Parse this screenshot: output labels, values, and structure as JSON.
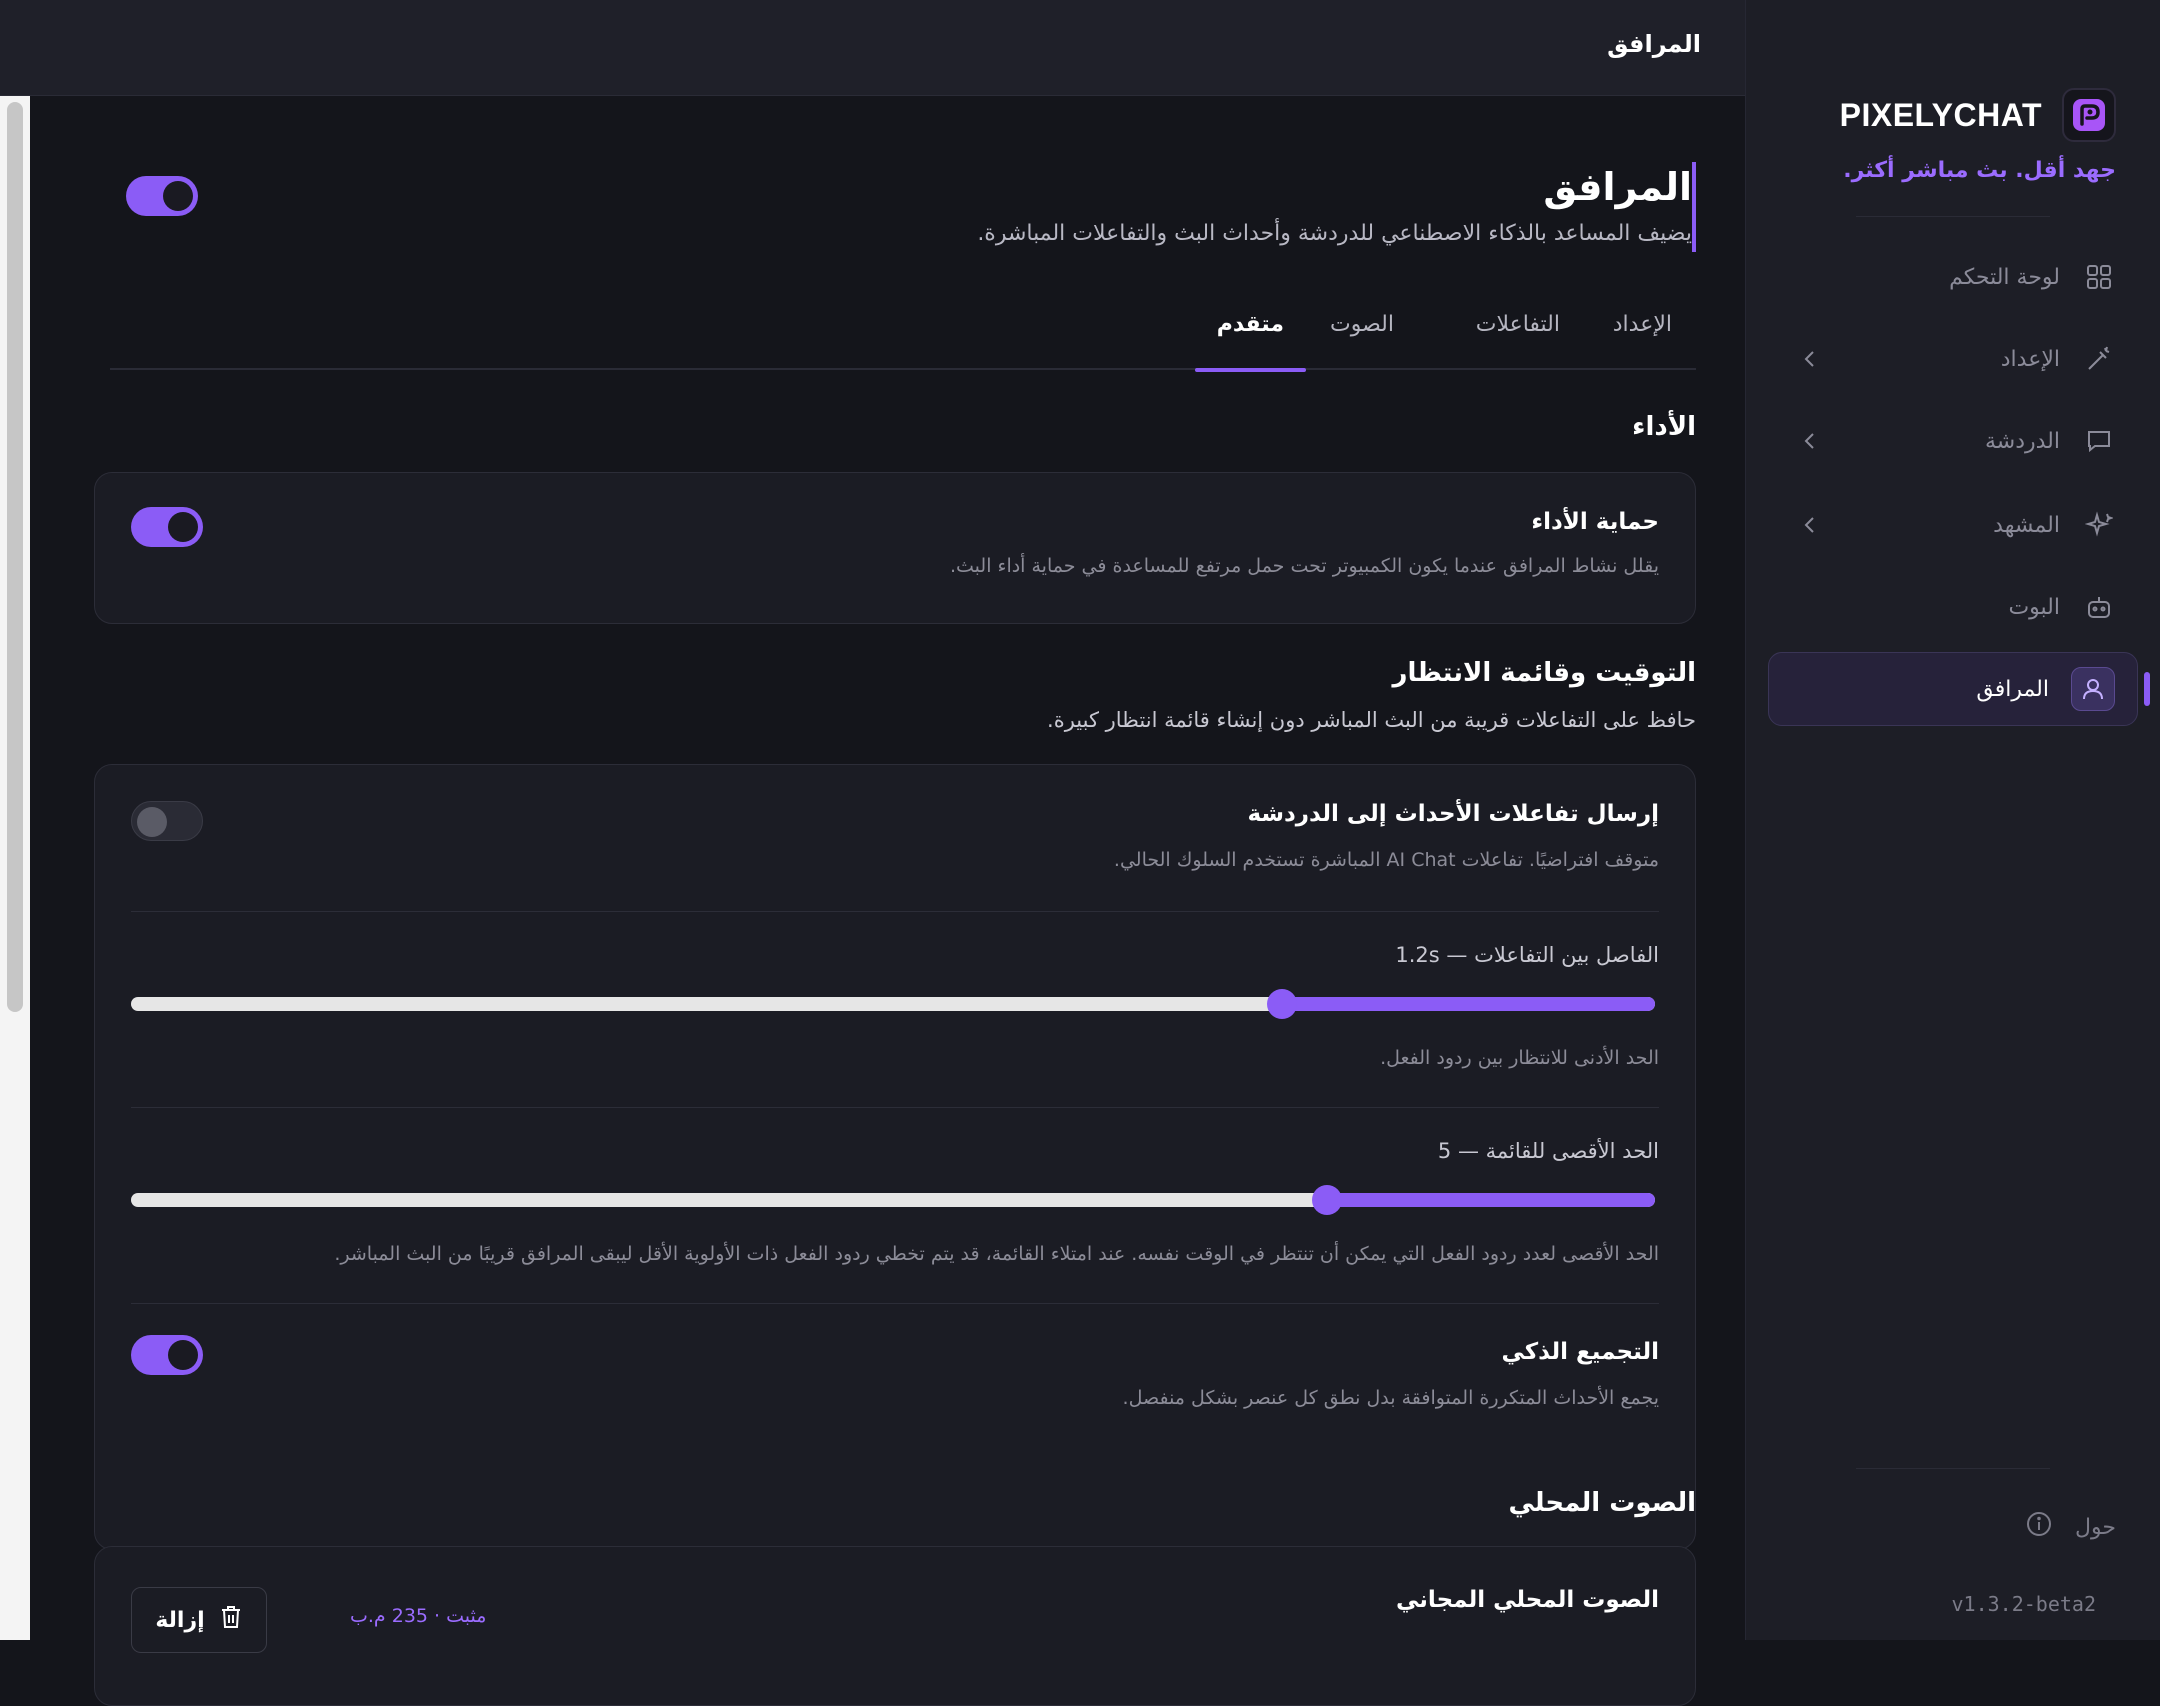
{
  "app": {
    "brand": "PIXELYCHAT",
    "tagline": "جهد أقل. بث مباشر أكثر.",
    "version": "v1.3.2-beta2"
  },
  "topbar": {
    "title": "المرافق"
  },
  "sidebar": {
    "items": [
      {
        "label": "لوحة التحكم",
        "icon": "grid-icon",
        "expandable": false
      },
      {
        "label": "الإعداد",
        "icon": "wand-icon",
        "expandable": true
      },
      {
        "label": "الدردشة",
        "icon": "chat-bubble-icon",
        "expandable": true
      },
      {
        "label": "المشهد",
        "icon": "sparkles-icon",
        "expandable": true
      },
      {
        "label": "البوت",
        "icon": "bot-icon",
        "expandable": false
      },
      {
        "label": "المرافق",
        "icon": "user-icon",
        "expandable": false,
        "active": true
      }
    ],
    "about_label": "حول"
  },
  "page": {
    "title": "المرافق",
    "subtitle": "يضيف المساعد بالذكاء الاصطناعي للدردشة وأحداث البث والتفاعلات المباشرة.",
    "enabled": true
  },
  "tabs": [
    {
      "label": "الإعداد",
      "active": false
    },
    {
      "label": "التفاعلات",
      "active": false
    },
    {
      "label": "الصوت",
      "active": false
    },
    {
      "label": "متقدم",
      "active": true
    }
  ],
  "sections": {
    "performance": {
      "title": "الأداء",
      "protection": {
        "title": "حماية الأداء",
        "description": "يقلل نشاط المرافق عندما يكون الكمبيوتر تحت حمل مرتفع للمساعدة في حماية أداء البث.",
        "enabled": true
      }
    },
    "timing": {
      "title": "التوقيت وقائمة الانتظار",
      "subtitle": "حافظ على التفاعلات قريبة من البث المباشر دون إنشاء قائمة انتظار كبيرة.",
      "send_events": {
        "title": "إرسال تفاعلات الأحداث إلى الدردشة",
        "description": "متوقف افتراضيًا. تفاعلات AI Chat المباشرة تستخدم السلوك الحالي.",
        "enabled": false
      },
      "interval": {
        "label": "الفاصل بين التفاعلات — 1.2s",
        "fraction": 0.245,
        "description": "الحد الأدنى للانتظار بين ردود الفعل."
      },
      "max_queue": {
        "label": "الحد الأقصى للقائمة — 5",
        "fraction": 0.215,
        "description": "الحد الأقصى لعدد ردود الفعل التي يمكن أن تنتظر في الوقت نفسه. عند امتلاء القائمة، قد يتم تخطي ردود الفعل ذات الأولوية الأقل ليبقى المرافق قريبًا من البث المباشر."
      },
      "smart_grouping": {
        "title": "التجميع الذكي",
        "description": "يجمع الأحداث المتكررة المتوافقة بدل نطق كل عنصر بشكل منفصل.",
        "enabled": true
      }
    },
    "local_voice": {
      "title": "الصوت المحلي",
      "free_voice": {
        "title": "الصوت المحلي المجاني",
        "status": "مثبت · 235 م.ب",
        "remove_label": "إزالة"
      }
    }
  },
  "colors": {
    "accent": "#8b5cf6",
    "background": "#14151b",
    "sidebar": "#1d1e26",
    "card": "#1b1c24"
  }
}
